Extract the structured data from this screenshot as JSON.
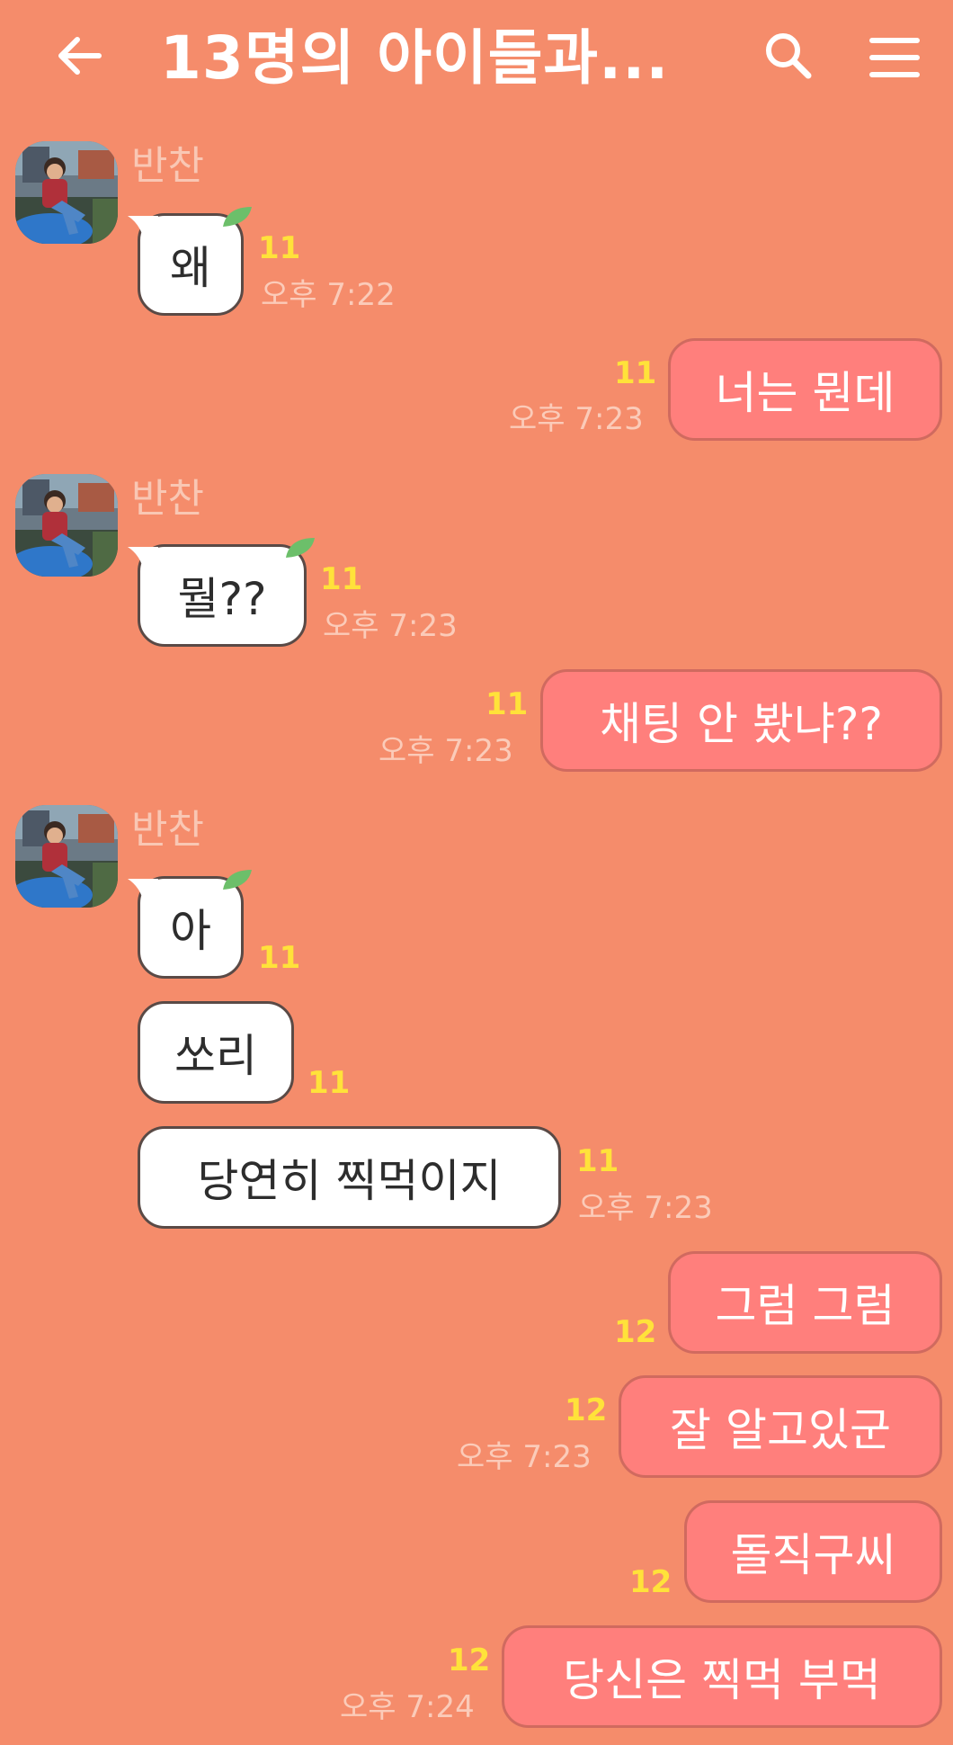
{
  "header": {
    "title": "13명의 아이들과...",
    "icons": {
      "back": "back-arrow-icon",
      "search": "search-icon",
      "menu": "menu-icon"
    }
  },
  "colors": {
    "background": "#F58C6B",
    "incoming_bubble": "#FFFFFF",
    "outgoing_bubble": "#FF7F7C",
    "unread_count": "#FFE23A",
    "timestamp": "#FBCBB9"
  },
  "messages": [
    {
      "sender": "반찬",
      "text": "왜",
      "unread": "11",
      "time": "오후 7:22"
    },
    {
      "text": "너는 뭔데",
      "unread": "11",
      "time": "오후 7:23"
    },
    {
      "sender": "반찬",
      "text": "뭘??",
      "unread": "11",
      "time": "오후 7:23"
    },
    {
      "text": "채팅 안 봤냐??",
      "unread": "11",
      "time": "오후 7:23"
    },
    {
      "sender": "반찬",
      "text": "아",
      "unread": "11"
    },
    {
      "text": "쏘리",
      "unread": "11"
    },
    {
      "text": "당연히 찍먹이지",
      "unread": "11",
      "time": "오후 7:23"
    },
    {
      "text": "그럼 그럼",
      "unread": "12"
    },
    {
      "text": "잘 알고있군",
      "unread": "12",
      "time": "오후 7:23"
    },
    {
      "text": "돌직구씨",
      "unread": "12"
    },
    {
      "text": "당신은 찍먹 부먹",
      "unread": "12",
      "time": "오후 7:24"
    }
  ]
}
